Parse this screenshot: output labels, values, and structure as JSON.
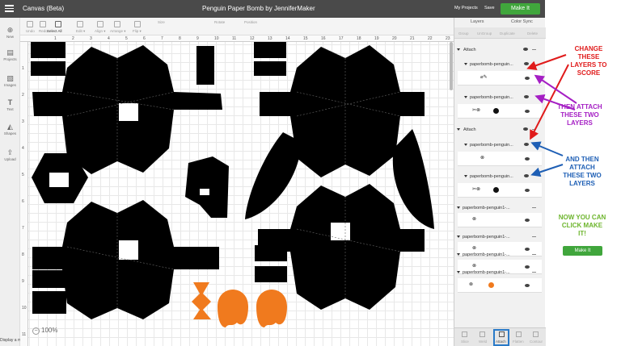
{
  "topbar": {
    "app_title": "Canvas (Beta)",
    "doc_title": "Penguin Paper Bomb by JenniferMaker",
    "my_projects": "My Projects",
    "save": "Save",
    "make_it": "Make It"
  },
  "toolbar": {
    "undo": "Undo",
    "redo": "Redo",
    "select_all": "Select All",
    "edit": "Edit ▾",
    "align": "Align ▾",
    "arrange": "Arrange ▾",
    "flip": "Flip ▾",
    "size": "Size",
    "rotate": "Rotate",
    "position": "Position"
  },
  "rail": {
    "new": "New",
    "projects": "Projects",
    "images": "Images",
    "text": "Text",
    "shapes": "Shapes",
    "upload": "Upload",
    "display_menu": "Display a menu"
  },
  "canvas": {
    "zoom": "100%",
    "ruler_top": [
      "1",
      "2",
      "3",
      "4",
      "5",
      "6",
      "7",
      "8",
      "9",
      "10",
      "11",
      "12",
      "13",
      "14",
      "15",
      "16",
      "17",
      "18",
      "19",
      "20",
      "21",
      "22",
      "23",
      "24"
    ],
    "ruler_left": [
      "1",
      "2",
      "3",
      "4",
      "5",
      "6",
      "7",
      "8",
      "9",
      "10",
      "11"
    ]
  },
  "panel": {
    "tab_layers": "Layers",
    "tab_color_sync": "Color Sync",
    "tools": [
      "Group",
      "UnGroup",
      "Duplicate",
      "Delete"
    ],
    "groups": [
      {
        "label": "Attach",
        "layers": [
          {
            "name": "paperbomb-penguin...",
            "ops": "⌀✎",
            "swatch": ""
          },
          {
            "name": "paperbomb-penguin...",
            "ops": "✂⊗",
            "swatch": "#111111"
          }
        ]
      },
      {
        "label": "Attach",
        "layers": [
          {
            "name": "paperbomb-penguin...",
            "ops": "⊗",
            "swatch": ""
          },
          {
            "name": "paperbomb-penguin...",
            "ops": "✂⊗",
            "swatch": "#111111"
          }
        ]
      }
    ],
    "singles": [
      {
        "name": "paperbomb-penguin1-...",
        "ops": "⊗",
        "swatch": ""
      },
      {
        "name": "paperbomb-penguin1-...",
        "ops": "⊗",
        "swatch": ""
      },
      {
        "name": "paperbomb-penguin1-...",
        "ops": "⊗",
        "swatch": ""
      },
      {
        "name": "paperbomb-penguin1-...",
        "ops": "⊗",
        "swatch": "#f07a1e"
      }
    ],
    "bottom": [
      "Slice",
      "Weld",
      "Attach",
      "Flatten",
      "Contour"
    ]
  },
  "annotations": {
    "step1": "CHANGE THESE LAYERS TO SCORE",
    "step2": "THEN ATTACH THESE TWO LAYERS",
    "step3": "AND THEN ATTACH THESE TWO LAYERS",
    "step4": "NOW YOU CAN CLICK MAKE IT!",
    "button": "Make It"
  },
  "colors": {
    "accent_green": "#40a63c",
    "annotation_red": "#e01b1b",
    "annotation_purple": "#a51fc4",
    "annotation_blue": "#1e5fb5",
    "annotation_green": "#6db52d",
    "orange_piece": "#f07a1e"
  }
}
